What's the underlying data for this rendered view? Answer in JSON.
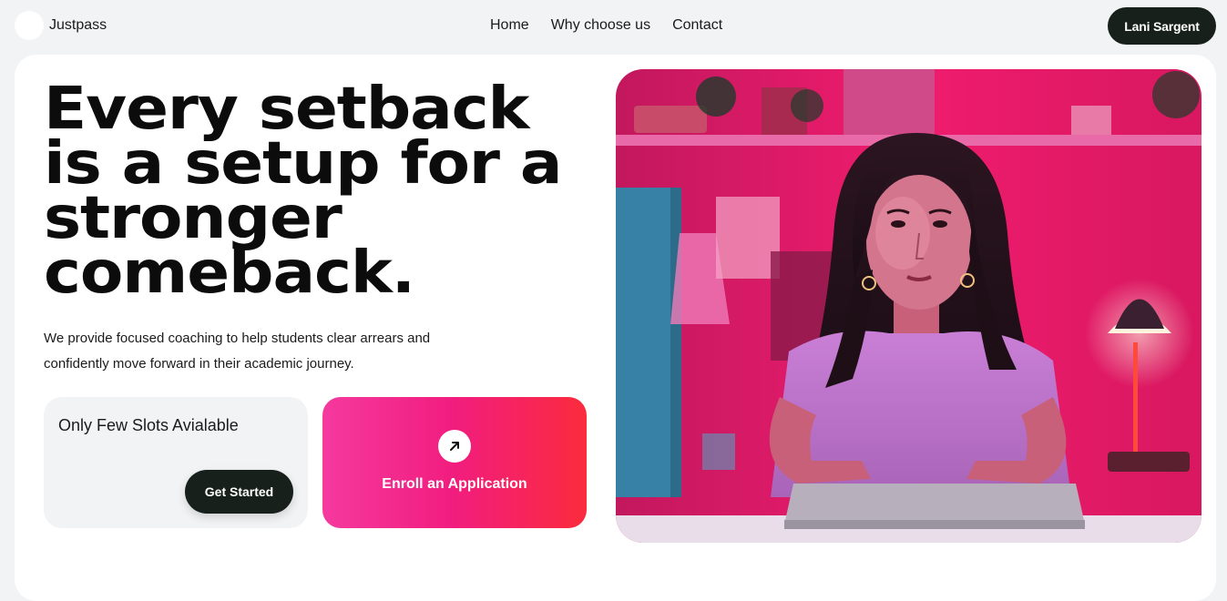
{
  "header": {
    "brand": "Justpass",
    "nav": [
      "Home",
      "Why choose us",
      "Contact"
    ],
    "user_name": "Lani Sargent"
  },
  "hero": {
    "headline_lines": [
      "Every setback",
      "is a setup for a",
      "stronger",
      "comeback."
    ],
    "subtext_lines": [
      "We provide focused coaching to help students clear arrears and",
      "confidently move forward in their academic journey."
    ],
    "slots_text": "Only Few Slots Avialable",
    "get_started_label": "Get Started",
    "enroll_label": "Enroll an Application",
    "enroll_icon": "arrow-up-right-icon",
    "image": "student-at-desk-photo"
  },
  "colors": {
    "page_bg": "#f2f3f5",
    "card_bg": "#ffffff",
    "dark_button": "#17201b",
    "gradient_start": "#f5399f",
    "gradient_end": "#fb2b3c"
  }
}
